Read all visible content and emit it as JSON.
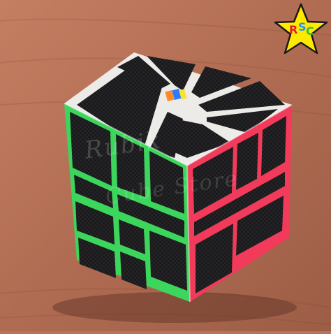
{
  "scene": {
    "subject": "square-1 puzzle cube",
    "colors": {
      "table_wood": "#b8745a",
      "tile_black": "#1c1c1e",
      "frame_white": "#f2f1ee",
      "frame_green": "#3dd65c",
      "frame_pink": "#f23a5a",
      "center_orange": "#ff8a2a",
      "center_blue": "#2a7cff",
      "center_yellow": "#f7e23a"
    }
  },
  "logo": {
    "letters": [
      "R",
      "S",
      "C"
    ],
    "star_color": "#ffe900",
    "letter_colors": [
      "#d81b3c",
      "#1e90ff",
      "#2fbf3a"
    ]
  },
  "watermark": {
    "line1": "Rubik",
    "line2": "Cube Store"
  }
}
